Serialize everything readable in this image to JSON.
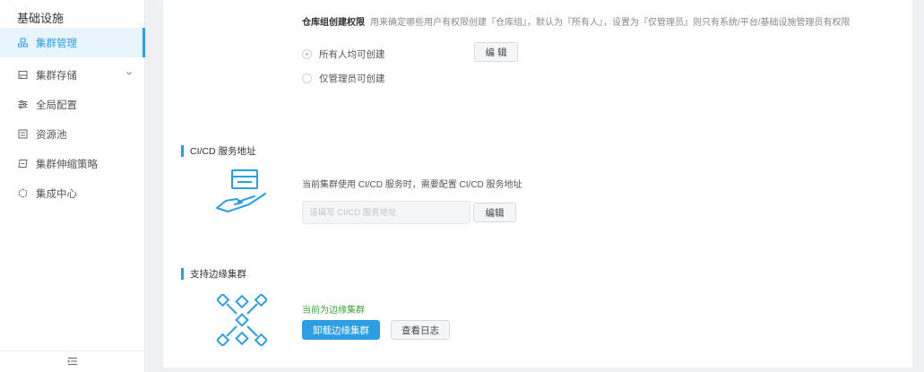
{
  "sidebar": {
    "title": "基础设施",
    "items": [
      {
        "label": "集群管理",
        "icon": "cluster-icon",
        "active": true
      },
      {
        "label": "集群存储",
        "icon": "storage-icon",
        "expandable": true
      },
      {
        "label": "全局配置",
        "icon": "sliders-icon"
      },
      {
        "label": "资源池",
        "icon": "pool-icon"
      },
      {
        "label": "集群伸缩策略",
        "icon": "scale-icon"
      },
      {
        "label": "集成中心",
        "icon": "integration-icon"
      }
    ],
    "footer_icon": "collapse-menu-icon"
  },
  "permission": {
    "title": "仓库组创建权限",
    "description": "用来确定哪些用户有权限创建『仓库组』，默认为『所有人』，设置为『仅管理员』则只有系统/平台/基础设施管理员有权限",
    "options": [
      {
        "label": "所有人均可创建",
        "checked": true
      },
      {
        "label": "仅管理员可创建",
        "checked": false
      }
    ],
    "edit_label": "编 辑"
  },
  "cicd": {
    "title": "CI/CD 服务地址",
    "description": "当前集群使用 CI/CD 服务时，需要配置 CI/CD 服务地址",
    "input_placeholder": "请填写 CI/CD 服务地址",
    "input_value": "",
    "edit_label": "编辑"
  },
  "edge": {
    "title": "支持边缘集群",
    "status": "当前为边缘集群",
    "uninstall_label": "卸载边缘集群",
    "logs_label": "查看日志"
  },
  "colors": {
    "accent": "#2b9ee6",
    "success": "#3aa73a"
  }
}
